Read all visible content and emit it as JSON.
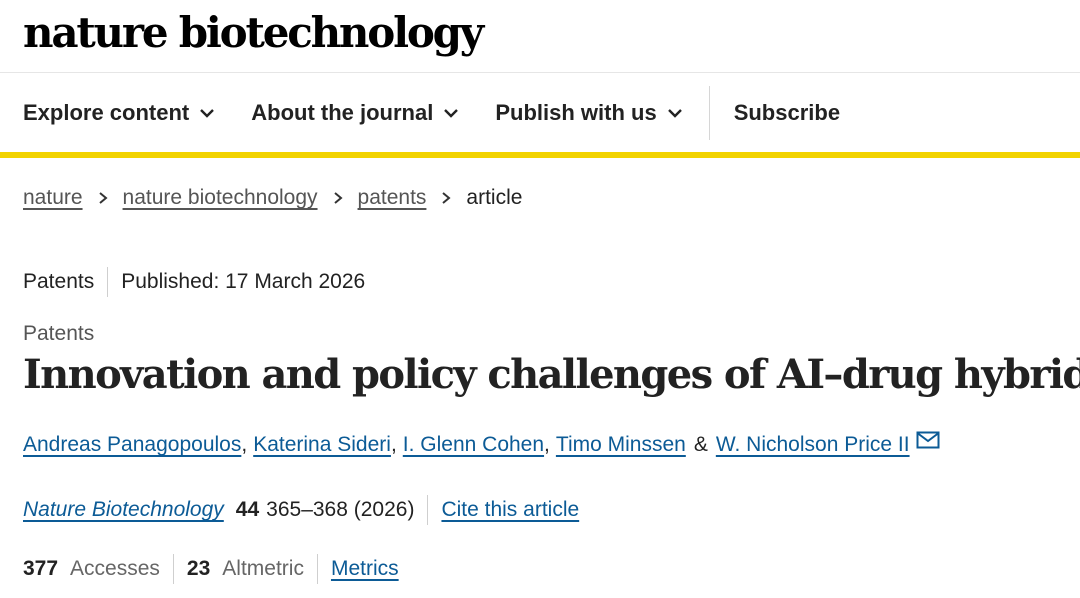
{
  "header": {
    "logo_text": "nature biotechnology"
  },
  "nav": {
    "items": [
      {
        "label": "Explore content",
        "has_dropdown": true
      },
      {
        "label": "About the journal",
        "has_dropdown": true
      },
      {
        "label": "Publish with us",
        "has_dropdown": true
      }
    ],
    "subscribe_label": "Subscribe",
    "accent_color": "#f2d300"
  },
  "breadcrumb": {
    "links": [
      "nature",
      "nature biotechnology",
      "patents"
    ],
    "current": "article"
  },
  "article": {
    "type_label": "Patents",
    "published": "Published: 17 March 2026",
    "kicker": "Patents",
    "title": "Innovation and policy challenges of AI–drug hybrids",
    "authors": [
      "Andreas Panagopoulos",
      "Katerina Sideri",
      "I. Glenn Cohen",
      "Timo Minssen",
      "W. Nicholson Price II"
    ],
    "author_separator": ",",
    "author_ampersand": "&",
    "citation": {
      "journal": "Nature Biotechnology",
      "volume": "44",
      "pages_year": "365–368 (2026)",
      "cite_label": "Cite this article"
    },
    "metrics": {
      "accesses_count": "377",
      "accesses_label": "Accesses",
      "altmetric_count": "23",
      "altmetric_label": "Altmetric",
      "metrics_link": "Metrics"
    }
  },
  "icons": [
    "chevron-down-icon",
    "chevron-right-icon",
    "mail-icon"
  ],
  "colors": {
    "link": "#0c5b96",
    "text": "#222222",
    "muted": "#555555"
  }
}
